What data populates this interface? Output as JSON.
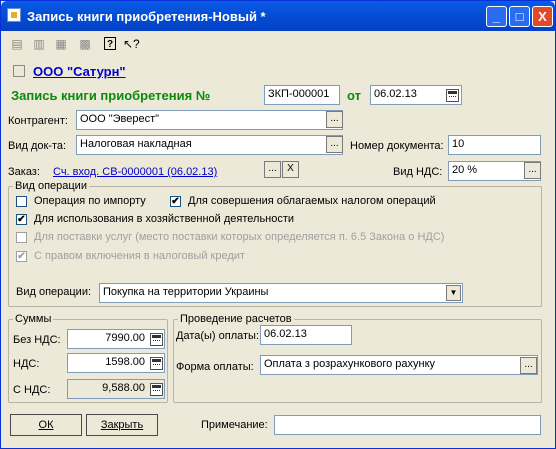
{
  "window": {
    "title": "Запись книги приобретения-Новый *",
    "buttons": [
      "_",
      "□",
      "X"
    ]
  },
  "toolbar": {
    "icons": [
      "doc-icon",
      "doc-dk-icon",
      "grid-icon",
      "table-icon",
      "help-icon",
      "whats-this-icon"
    ],
    "help_label": "?",
    "whatsthis_label": "↖?"
  },
  "org": {
    "name": "ООО \"Сатурн\""
  },
  "header": {
    "record_label": "Запись книги приобретения №",
    "number": "ЗКП-000001",
    "from_label": "от",
    "date": "06.02.13"
  },
  "form": {
    "contractor_label": "Контрагент:",
    "contractor_value": "ООО \"Эверест\"",
    "doctype_label": "Вид док-та:",
    "doctype_value": "Налоговая накладная",
    "docnum_label": "Номер документа:",
    "docnum_value": "10",
    "order_label": "Заказ:",
    "order_value": "Сч. вход. СВ-0000001 (06.02.13)",
    "order_clear": "X",
    "vat_label": "Вид НДС:",
    "vat_value": "20 %",
    "ellipsis": "..."
  },
  "operation": {
    "group_label": "Вид операции",
    "import_label": "Операция по импорту",
    "import_checked": false,
    "taxable_label": "Для совершения облагаемых налогом операций",
    "taxable_checked": true,
    "business_label": "Для использования в хозяйственной деятельности",
    "business_checked": true,
    "services_label": "Для поставки услуг (место поставки которых определяется п. 6.5 Закона о НДС)",
    "services_checked": false,
    "credit_label": "С правом включения в налоговый кредит",
    "credit_checked": true,
    "optype_label": "Вид операции:",
    "optype_value": "Покупка на территории Украины",
    "check_mark": "✔"
  },
  "sums": {
    "group_label": "Суммы",
    "without_vat_label": "Без НДС:",
    "without_vat_value": "7990.00",
    "vat_label": "НДС:",
    "vat_value": "1598.00",
    "with_vat_label": "С НДС:",
    "with_vat_value": "9,588.00"
  },
  "payment": {
    "group_label": "Проведение расчетов",
    "date_label": "Дата(ы) оплаты:",
    "date_value": "06.02.13",
    "form_label": "Форма оплаты:",
    "form_value": "Оплата з розрахункового рахунку"
  },
  "footer": {
    "ok_label": "ОК",
    "close_label": "Закрыть",
    "note_label": "Примечание:",
    "note_value": ""
  }
}
